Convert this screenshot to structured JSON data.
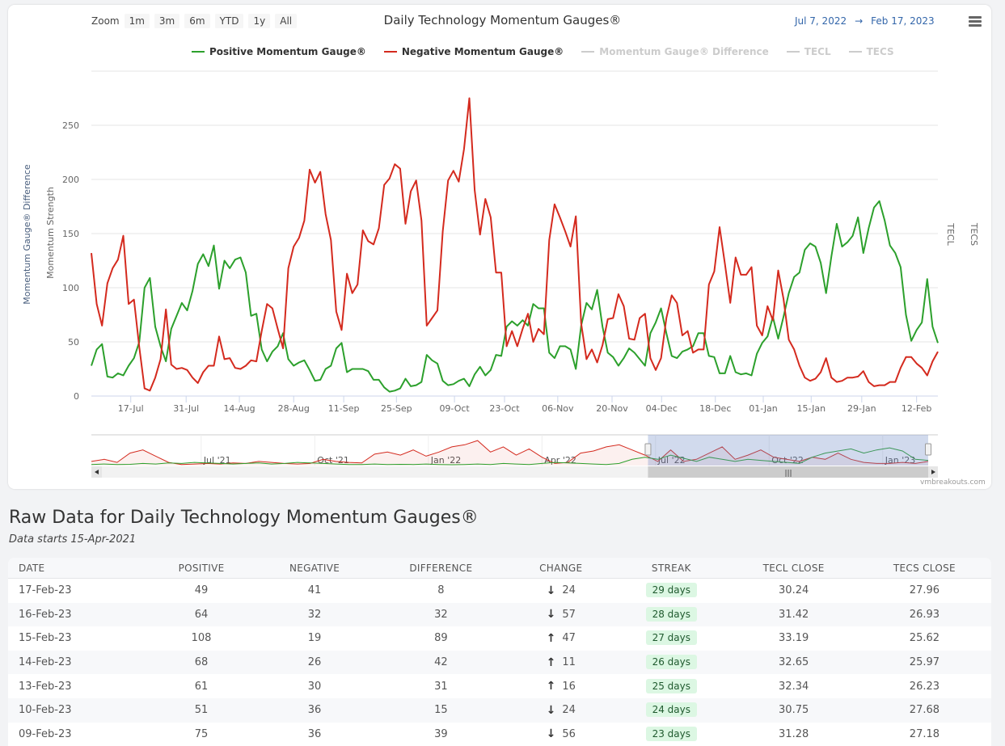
{
  "chart": {
    "title": "Daily Technology Momentum Gauges®",
    "zoom_label": "Zoom",
    "zoom_buttons": [
      "1m",
      "3m",
      "6m",
      "YTD",
      "1y",
      "All"
    ],
    "range_from": "Jul 7, 2022",
    "range_arrow": "→",
    "range_to": "Feb 17, 2023",
    "credit": "vmbreakouts.com"
  },
  "chart_data": {
    "type": "line",
    "title": "Daily Technology Momentum Gauges®",
    "ylabel": "Momentum Strength",
    "ylabel2": "Momentum Gauge® Difference",
    "right_axis_labels": [
      "TECL",
      "TECS"
    ],
    "ylim": [
      0,
      300
    ],
    "yticks": [
      0,
      50,
      100,
      150,
      200,
      250
    ],
    "x_unit": "trading days since Jul 7, 2022",
    "xlim": [
      0,
      159
    ],
    "xticks": [
      {
        "label": "17-Jul",
        "pos": 7.4
      },
      {
        "label": "31-Jul",
        "pos": 17.8
      },
      {
        "label": "14-Aug",
        "pos": 27.8
      },
      {
        "label": "28-Aug",
        "pos": 38.0
      },
      {
        "label": "11-Sep",
        "pos": 47.4
      },
      {
        "label": "25-Sep",
        "pos": 57.3
      },
      {
        "label": "09-Oct",
        "pos": 68.2
      },
      {
        "label": "23-Oct",
        "pos": 77.6
      },
      {
        "label": "06-Nov",
        "pos": 87.6
      },
      {
        "label": "20-Nov",
        "pos": 97.8
      },
      {
        "label": "04-Dec",
        "pos": 107.1
      },
      {
        "label": "18-Dec",
        "pos": 117.2
      },
      {
        "label": "01-Jan",
        "pos": 126.2
      },
      {
        "label": "15-Jan",
        "pos": 135.2
      },
      {
        "label": "29-Jan",
        "pos": 144.7
      },
      {
        "label": "12-Feb",
        "pos": 155.0
      }
    ],
    "legend": [
      {
        "name": "Positive Momentum Gauge®",
        "color": "#2ca02c",
        "visible": true
      },
      {
        "name": "Negative Momentum Gauge®",
        "color": "#d42a1e",
        "visible": true
      },
      {
        "name": "Momentum Gauge® Difference",
        "color": "#cccccc",
        "visible": false
      },
      {
        "name": "TECL",
        "color": "#cccccc",
        "visible": false
      },
      {
        "name": "TECS",
        "color": "#cccccc",
        "visible": false
      }
    ],
    "legend_position": "top-center",
    "series": [
      {
        "name": "Positive Momentum Gauge®",
        "color": "#2ca02c",
        "values": [
          28,
          43,
          48,
          18,
          17,
          21,
          19,
          28,
          35,
          50,
          100,
          109,
          64,
          46,
          32,
          62,
          74,
          86,
          79,
          97,
          122,
          131,
          120,
          139,
          99,
          125,
          118,
          126,
          128,
          114,
          74,
          76,
          43,
          32,
          41,
          46,
          58,
          34,
          28,
          31,
          33,
          24,
          14,
          15,
          25,
          28,
          44,
          49,
          22,
          25,
          25,
          25,
          23,
          15,
          15,
          8,
          4,
          5,
          7,
          16,
          9,
          10,
          13,
          38,
          33,
          30,
          14,
          10,
          11,
          14,
          16,
          9,
          20,
          27,
          19,
          24,
          38,
          37,
          64,
          69,
          65,
          70,
          65,
          85,
          81,
          81,
          40,
          35,
          46,
          46,
          43,
          25,
          65,
          86,
          80,
          98,
          64,
          40,
          36,
          28,
          35,
          44,
          40,
          34,
          28,
          58,
          68,
          81,
          58,
          37,
          35,
          41,
          43,
          46,
          58,
          58,
          37,
          36,
          21,
          21,
          37,
          22,
          20,
          21,
          19,
          39,
          49,
          55,
          73,
          53,
          73,
          95,
          110,
          114,
          135,
          141,
          138,
          123,
          95,
          129,
          159,
          138,
          142,
          148,
          165,
          132,
          155,
          174,
          180,
          162,
          139,
          132,
          119,
          75,
          51,
          61,
          68,
          108,
          64,
          49
        ]
      },
      {
        "name": "Negative Momentum Gauge®",
        "color": "#d42a1e",
        "values": [
          132,
          85,
          65,
          104,
          118,
          126,
          148,
          85,
          89,
          45,
          7,
          5,
          17,
          34,
          80,
          29,
          25,
          26,
          24,
          17,
          12,
          22,
          28,
          28,
          55,
          34,
          35,
          26,
          25,
          28,
          33,
          32,
          60,
          85,
          81,
          62,
          44,
          118,
          138,
          146,
          162,
          209,
          197,
          207,
          168,
          144,
          78,
          61,
          113,
          95,
          103,
          153,
          143,
          140,
          155,
          195,
          201,
          214,
          210,
          159,
          189,
          199,
          162,
          65,
          72,
          79,
          152,
          199,
          208,
          198,
          228,
          275,
          190,
          149,
          182,
          165,
          114,
          114,
          46,
          60,
          46,
          62,
          76,
          50,
          62,
          57,
          144,
          177,
          165,
          152,
          138,
          166,
          67,
          34,
          43,
          31,
          47,
          71,
          72,
          94,
          83,
          53,
          52,
          72,
          76,
          35,
          24,
          35,
          72,
          93,
          86,
          56,
          60,
          40,
          43,
          43,
          103,
          115,
          156,
          122,
          86,
          128,
          112,
          112,
          119,
          65,
          56,
          83,
          70,
          116,
          90,
          52,
          43,
          28,
          17,
          14,
          16,
          22,
          35,
          17,
          13,
          14,
          17,
          17,
          18,
          23,
          13,
          9,
          10,
          10,
          13,
          13,
          26,
          36,
          36,
          30,
          26,
          19,
          32,
          41
        ]
      }
    ],
    "navigator": {
      "x_unit": "months since Apr 15, 2021",
      "xlim": [
        0,
        22.1
      ],
      "selected": [
        14.7,
        22.1
      ],
      "xticks": [
        {
          "label": "Jul '21",
          "pos": 2.9
        },
        {
          "label": "Oct '21",
          "pos": 5.9
        },
        {
          "label": "Jan '22",
          "pos": 8.9
        },
        {
          "label": "Apr '22",
          "pos": 11.9
        },
        {
          "label": "Jul '22",
          "pos": 14.9
        },
        {
          "label": "Oct '22",
          "pos": 17.9
        },
        {
          "label": "Jan '23",
          "pos": 20.9
        }
      ],
      "negative": [
        40,
        60,
        30,
        120,
        150,
        90,
        30,
        10,
        15,
        20,
        15,
        25,
        20,
        40,
        30,
        20,
        15,
        20,
        60,
        40,
        30,
        25,
        110,
        130,
        100,
        150,
        90,
        130,
        180,
        200,
        240,
        130,
        180,
        100,
        160,
        80,
        20,
        30,
        120,
        140,
        180,
        200,
        150,
        100,
        40,
        150,
        40,
        60,
        120,
        180,
        60,
        100,
        150,
        80,
        60,
        40,
        80,
        60,
        120,
        60,
        30,
        20,
        20,
        30,
        20,
        40
      ],
      "positive": [
        10,
        15,
        10,
        12,
        20,
        15,
        25,
        20,
        30,
        25,
        20,
        15,
        20,
        25,
        15,
        20,
        30,
        25,
        20,
        15,
        10,
        10,
        15,
        10,
        12,
        10,
        15,
        10,
        8,
        10,
        15,
        10,
        20,
        15,
        10,
        20,
        30,
        25,
        20,
        15,
        10,
        20,
        60,
        80,
        60,
        100,
        70,
        40,
        80,
        60,
        40,
        60,
        50,
        40,
        30,
        20,
        80,
        120,
        140,
        160,
        120,
        150,
        170,
        140,
        60,
        50
      ]
    }
  },
  "raw": {
    "heading": "Raw Data for Daily Technology Momentum Gauges®",
    "subheading": "Data starts 15-Apr-2021",
    "columns": [
      "DATE",
      "POSITIVE",
      "NEGATIVE",
      "DIFFERENCE",
      "CHANGE",
      "STREAK",
      "TECL CLOSE",
      "TECS CLOSE"
    ],
    "rows": [
      {
        "date": "17-Feb-23",
        "positive": "49",
        "negative": "41",
        "difference": "8",
        "dir": "↓",
        "change": "24",
        "streak": "29 days",
        "tecl": "30.24",
        "tecs": "27.96"
      },
      {
        "date": "16-Feb-23",
        "positive": "64",
        "negative": "32",
        "difference": "32",
        "dir": "↓",
        "change": "57",
        "streak": "28 days",
        "tecl": "31.42",
        "tecs": "26.93"
      },
      {
        "date": "15-Feb-23",
        "positive": "108",
        "negative": "19",
        "difference": "89",
        "dir": "↑",
        "change": "47",
        "streak": "27 days",
        "tecl": "33.19",
        "tecs": "25.62"
      },
      {
        "date": "14-Feb-23",
        "positive": "68",
        "negative": "26",
        "difference": "42",
        "dir": "↑",
        "change": "11",
        "streak": "26 days",
        "tecl": "32.65",
        "tecs": "25.97"
      },
      {
        "date": "13-Feb-23",
        "positive": "61",
        "negative": "30",
        "difference": "31",
        "dir": "↑",
        "change": "16",
        "streak": "25 days",
        "tecl": "32.34",
        "tecs": "26.23"
      },
      {
        "date": "10-Feb-23",
        "positive": "51",
        "negative": "36",
        "difference": "15",
        "dir": "↓",
        "change": "24",
        "streak": "24 days",
        "tecl": "30.75",
        "tecs": "27.68"
      },
      {
        "date": "09-Feb-23",
        "positive": "75",
        "negative": "36",
        "difference": "39",
        "dir": "↓",
        "change": "56",
        "streak": "23 days",
        "tecl": "31.28",
        "tecs": "27.18"
      }
    ]
  }
}
